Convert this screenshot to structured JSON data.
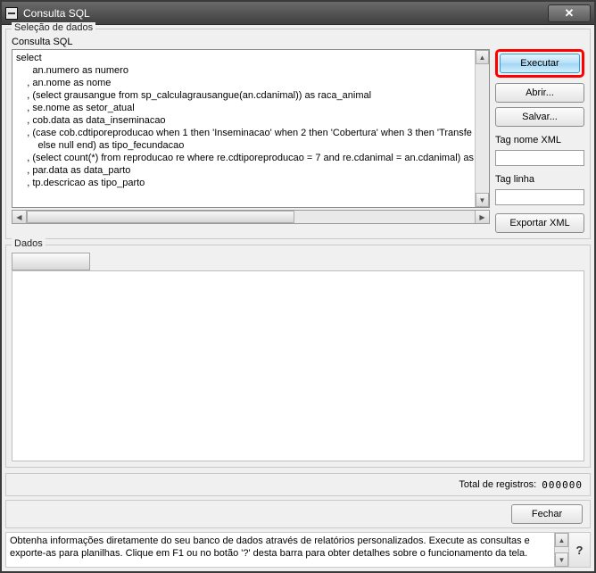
{
  "window": {
    "title": "Consulta SQL"
  },
  "selecao": {
    "label": "Seleção de dados",
    "query_label": "Consulta SQL",
    "sql": "select\n      an.numero as numero\n    , an.nome as nome\n    , (select grausangue from sp_calculagrausangue(an.cdanimal)) as raca_animal\n    , se.nome as setor_atual\n    , cob.data as data_inseminacao\n    , (case cob.cdtiporeproducao when 1 then 'Inseminacao' when 2 then 'Cobertura' when 3 then 'Transfe\n        else null end) as tipo_fecundacao\n    , (select count(*) from reproducao re where re.cdtiporeproducao = 7 and re.cdanimal = an.cdanimal) as\n    , par.data as data_parto\n    , tp.descricao as tipo_parto"
  },
  "buttons": {
    "executar": "Executar",
    "abrir": "Abrir...",
    "salvar": "Salvar...",
    "exportar": "Exportar XML",
    "fechar": "Fechar"
  },
  "labels": {
    "tag_nome_xml": "Tag nome XML",
    "tag_linha": "Tag linha",
    "dados": "Dados",
    "total_registros": "Total de registros:"
  },
  "inputs": {
    "tag_nome_xml": "",
    "tag_linha": ""
  },
  "totals": {
    "count": "000000"
  },
  "info": {
    "text": "Obtenha informações diretamente do seu banco de dados através de relatórios personalizados. Execute as consultas e exporte-as para planilhas. Clique em F1 ou no botão '?' desta barra para obter detalhes sobre o funcionamento da tela."
  }
}
